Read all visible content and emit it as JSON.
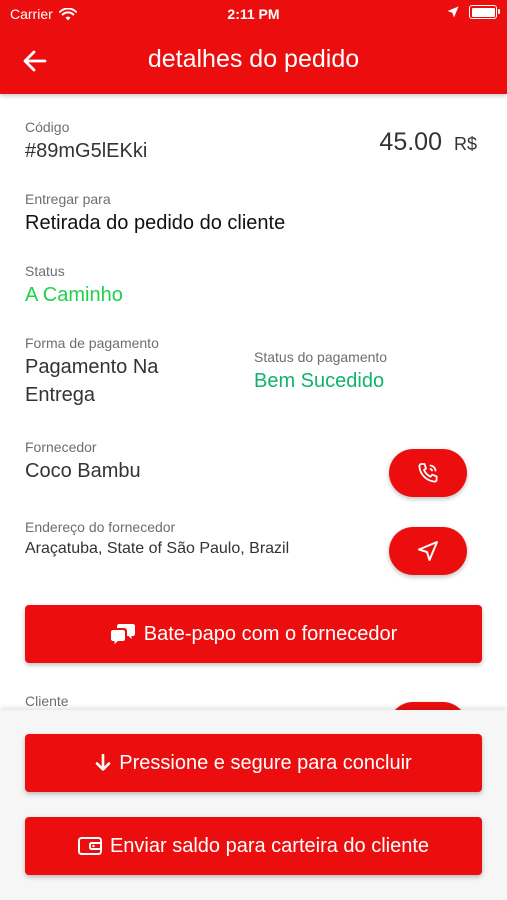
{
  "status_bar": {
    "carrier": "Carrier",
    "time": "2:11 PM"
  },
  "header": {
    "title": "detalhes do pedido",
    "back_icon": "arrow-left-icon"
  },
  "order": {
    "code_label": "Código",
    "code": "#89mG5lEKki",
    "amount": "45.00",
    "currency": "R$",
    "deliver_label": "Entregar para",
    "deliver_value": "Retirada do pedido do cliente",
    "status_label": "Status",
    "status_value": "A Caminho",
    "payment_label": "Forma de pagamento",
    "payment_value_line1": "Pagamento Na",
    "payment_value_line2": "Entrega",
    "payment_status_label": "Status do pagamento",
    "payment_status_value": "Bem Sucedido"
  },
  "supplier": {
    "label": "Fornecedor",
    "name": "Coco Bambu",
    "address_label": "Endereço do fornecedor",
    "address": "Araçatuba, State of São Paulo, Brazil",
    "call_icon": "phone-icon",
    "nav_icon": "navigation-icon"
  },
  "chat_button": {
    "label": "Bate-papo com o fornecedor",
    "icon": "chat-icon"
  },
  "client": {
    "label": "Cliente"
  },
  "actions": {
    "complete_label": "Pressione e segure para concluir",
    "complete_icon": "arrow-down-icon",
    "wallet_label": "Enviar saldo para carteira do cliente",
    "wallet_icon": "wallet-icon"
  },
  "colors": {
    "primary": "#ec0e0e",
    "status_green": "#1ed24a",
    "success_teal": "#11b26b"
  }
}
